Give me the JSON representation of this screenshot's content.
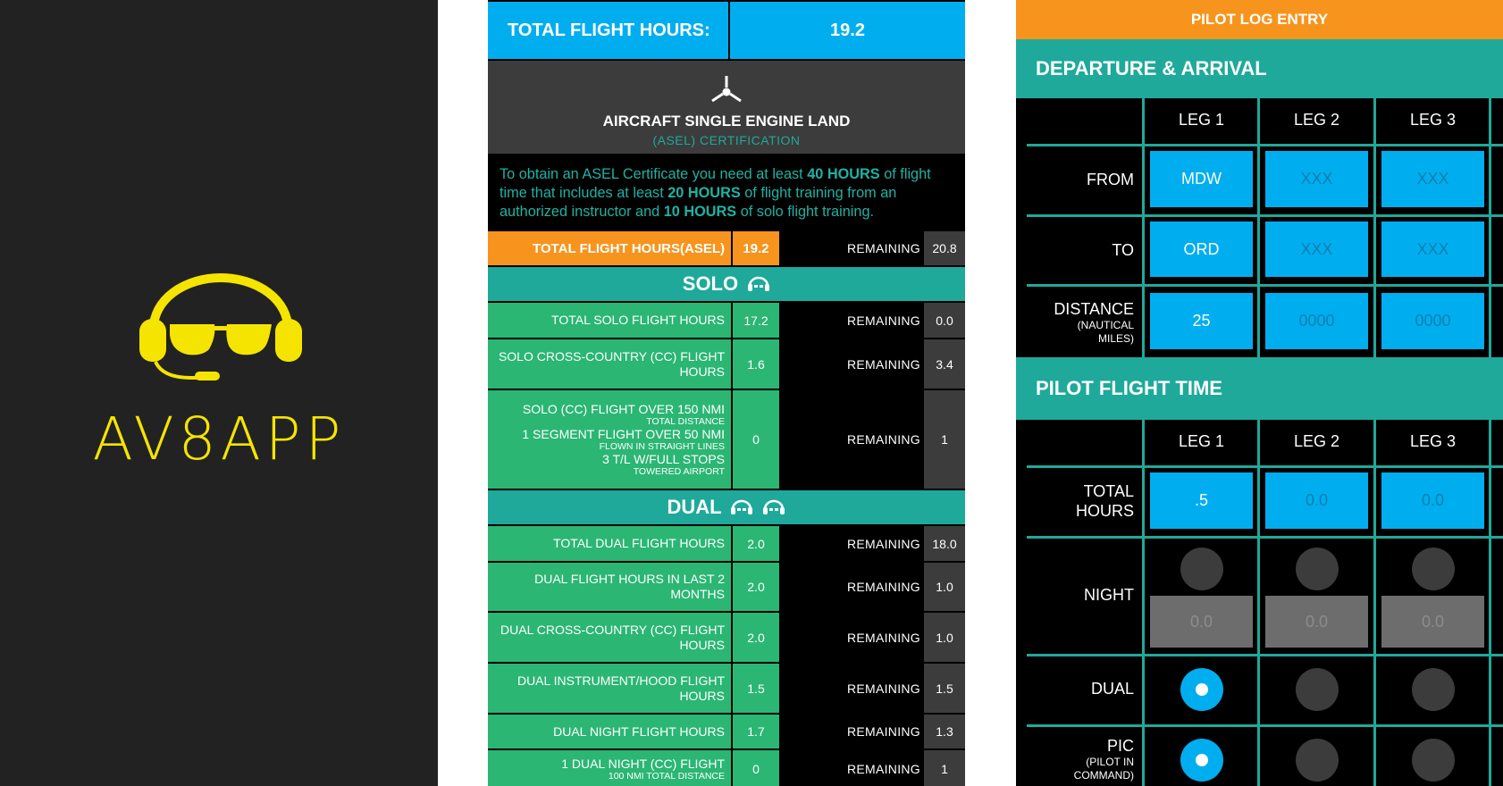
{
  "splash": {
    "app_name": "AV8APP",
    "logo_icon": "pilot-headset-aviator-icon",
    "logo_color": "#f5e400",
    "background": "#222222"
  },
  "progress": {
    "header": {
      "label": "TOTAL FLIGHT HOURS:",
      "value": "19.2"
    },
    "certification": {
      "icon": "propeller-icon",
      "title": "AIRCRAFT SINGLE ENGINE LAND",
      "subtitle": "(ASEL) CERTIFICATION"
    },
    "info": {
      "t1": "To obtain an ASEL Certificate you need at least ",
      "b1": "40 HOURS",
      "t2": " of flight time that includes at least ",
      "b2": "20 HOURS",
      "t3": " of flight training from an authorized instructor and ",
      "b3": "10 HOURS",
      "t4": " of solo flight training."
    },
    "total_row": {
      "label": "TOTAL FLIGHT HOURS(ASEL)",
      "value": "19.2",
      "remaining_label": "REMAINING",
      "remaining": "20.8"
    },
    "solo": {
      "title": "SOLO",
      "rows": [
        {
          "label": "TOTAL SOLO FLIGHT HOURS",
          "value": "17.2",
          "remaining_label": "REMAINING",
          "remaining": "0.0"
        },
        {
          "label": "SOLO CROSS-COUNTRY (CC) FLIGHT HOURS",
          "value": "1.6",
          "remaining_label": "REMAINING",
          "remaining": "3.4"
        },
        {
          "line1": "SOLO (CC) FLIGHT OVER 150 NMI",
          "note1": "TOTAL DISTANCE",
          "line2": "1 SEGMENT FLIGHT OVER 50 NMI",
          "note2": "FLOWN IN STRAIGHT LINES",
          "line3": "3 T/L W/FULL STOPS",
          "note3": "TOWERED AIRPORT",
          "value": "0",
          "remaining_label": "REMAINING",
          "remaining": "1"
        }
      ]
    },
    "dual": {
      "title": "DUAL",
      "rows": [
        {
          "label": "TOTAL DUAL FLIGHT HOURS",
          "value": "2.0",
          "remaining_label": "REMAINING",
          "remaining": "18.0"
        },
        {
          "label": "DUAL FLIGHT HOURS IN LAST 2 MONTHS",
          "value": "2.0",
          "remaining_label": "REMAINING",
          "remaining": "1.0"
        },
        {
          "label": "DUAL CROSS-COUNTRY (CC) FLIGHT HOURS",
          "value": "2.0",
          "remaining_label": "REMAINING",
          "remaining": "1.0"
        },
        {
          "label": "DUAL INSTRUMENT/HOOD FLIGHT HOURS",
          "value": "1.5",
          "remaining_label": "REMAINING",
          "remaining": "1.5"
        },
        {
          "label": "DUAL NIGHT FLIGHT HOURS",
          "value": "1.7",
          "remaining_label": "REMAINING",
          "remaining": "1.3"
        },
        {
          "line1": "1 DUAL NIGHT (CC) FLIGHT",
          "note1": "100 NMI TOTAL DISTANCE",
          "value": "0",
          "remaining_label": "REMAINING",
          "remaining": "1"
        }
      ]
    }
  },
  "log": {
    "title": "PILOT LOG ENTRY",
    "departure_arrival": {
      "title": "DEPARTURE & ARRIVAL",
      "legs": [
        "LEG 1",
        "LEG 2",
        "LEG 3"
      ],
      "from": {
        "label": "FROM",
        "values": [
          "MDW",
          "XXX",
          "XXX"
        ]
      },
      "to": {
        "label": "TO",
        "values": [
          "ORD",
          "XXX",
          "XXX"
        ]
      },
      "distance": {
        "label": "DISTANCE",
        "note": "(NAUTICAL MILES)",
        "values": [
          "25",
          "0000",
          "0000"
        ]
      }
    },
    "flight_time": {
      "title": "PILOT FLIGHT TIME",
      "legs": [
        "LEG 1",
        "LEG 2",
        "LEG 3"
      ],
      "total_hours": {
        "label1": "TOTAL",
        "label2": "HOURS",
        "values": [
          ".5",
          "0.0",
          "0.0"
        ]
      },
      "night": {
        "label": "NIGHT",
        "selected": [
          false,
          false,
          false
        ],
        "values": [
          "0.0",
          "0.0",
          "0.0"
        ]
      },
      "dual": {
        "label": "DUAL",
        "selected": [
          true,
          false,
          false
        ]
      },
      "pic": {
        "label": "PIC",
        "note": "(PILOT IN COMMAND)",
        "selected": [
          true,
          false,
          false
        ]
      }
    }
  },
  "colors": {
    "blue": "#00aeef",
    "teal": "#1fa99a",
    "green": "#2bb673",
    "orange": "#f7941d",
    "dark_gray": "#3c3c3c"
  }
}
